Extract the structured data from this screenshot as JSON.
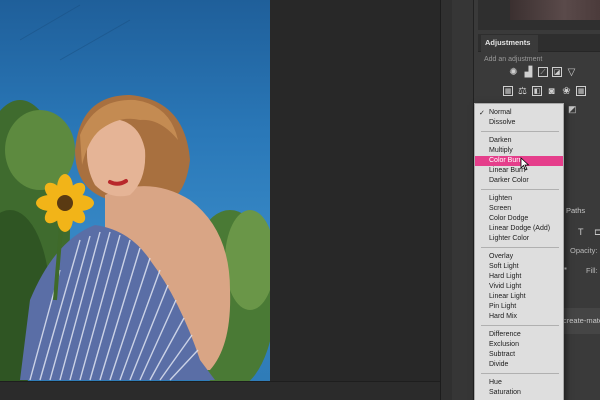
{
  "adjustments_panel": {
    "tab_label": "Adjustments",
    "subtitle": "Add an adjustment",
    "row1_icons": [
      "brightness-icon",
      "levels-icon",
      "curves-icon",
      "exposure-icon",
      "gradient-triangle-icon"
    ],
    "row2_icons": [
      "vibrance-icon",
      "balance-icon",
      "bw-icon",
      "camera-icon",
      "channel-icon",
      "grid-icon"
    ]
  },
  "layers_panel": {
    "paths_tab": "Paths",
    "opacity_label": "Opacity:",
    "fill_label": "Fill:",
    "layer_name": "create-mater"
  },
  "blend_menu": {
    "checked_item": "Normal",
    "groups": [
      [
        "Normal",
        "Dissolve"
      ],
      [
        "Darken",
        "Multiply",
        "Color Burn",
        "Linear Burn",
        "Darker Color"
      ],
      [
        "Lighten",
        "Screen",
        "Color Dodge",
        "Linear Dodge (Add)",
        "Lighter Color"
      ],
      [
        "Overlay",
        "Soft Light",
        "Hard Light",
        "Vivid Light",
        "Linear Light",
        "Pin Light",
        "Hard Mix"
      ],
      [
        "Difference",
        "Exclusion",
        "Subtract",
        "Divide"
      ],
      [
        "Hue",
        "Saturation"
      ]
    ],
    "selected": "Color Burn",
    "selected_color": "#e53e8b"
  }
}
